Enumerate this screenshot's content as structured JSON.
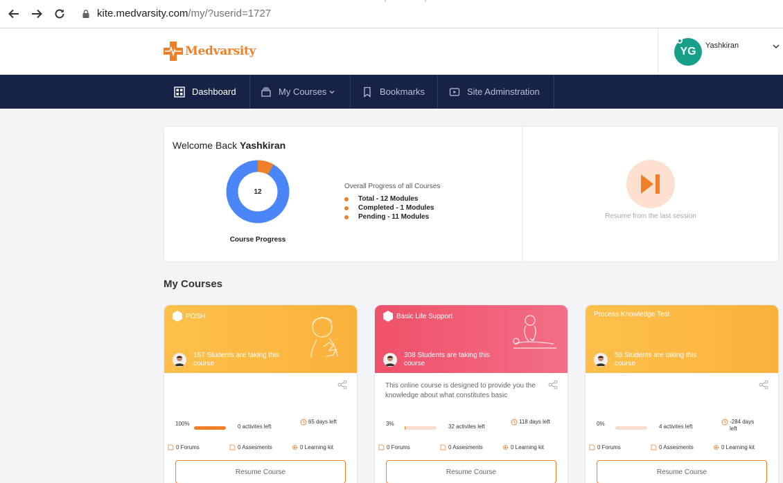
{
  "browser": {
    "url_host": "kite.medvarsity.com",
    "url_path": "/my/?userid=1727"
  },
  "header": {
    "logo_text": "Medvarsity",
    "user_initials": "YG",
    "user_name": "Yashkiran"
  },
  "nav": {
    "items": [
      {
        "label": "Dashboard",
        "icon": "dashboard-grid-icon",
        "active": true
      },
      {
        "label": "My Courses",
        "icon": "courses-stack-icon",
        "active": false
      },
      {
        "label": "Bookmarks",
        "icon": "bookmark-icon",
        "active": false
      },
      {
        "label": "Site Adminstration",
        "icon": "video-icon",
        "active": false
      }
    ]
  },
  "welcome": {
    "prefix": "Welcome Back",
    "name": "Yashkiran",
    "donut_center": "12",
    "donut_label": "Course Progress",
    "completed_fraction": 0.0833,
    "progress_heading": "Overall Progress of all Courses",
    "legend": [
      "Total - 12 Modules",
      "Completed - 1 Modules",
      "Pending - 11 Modules"
    ],
    "resume_label": "Resume from the last session"
  },
  "section": {
    "my_courses": "My Courses"
  },
  "courses": [
    {
      "title": "POSH",
      "students": "167 Students are taking this course",
      "description": "",
      "percent": "100%",
      "progress_fraction": 1.0,
      "activities_left": "0 activites left",
      "days_left": "65 days left",
      "forums": "0 Forums",
      "assessments": "0 Assesments",
      "learning_kit": "0 Learning kit",
      "button": "Resume Course",
      "theme": "yellow"
    },
    {
      "title": "Basic Life Support",
      "students": "308 Students are taking this course",
      "description": "This online course is designed to provide you the knowledge about what constitutes basic",
      "percent": "3%",
      "progress_fraction": 0.03,
      "activities_left": "32 activites left",
      "days_left": "118 days left",
      "forums": "0 Forums",
      "assessments": "0 Assesments",
      "learning_kit": "0 Learning kit",
      "button": "Resume Course",
      "theme": "pink"
    },
    {
      "title": "Process Knowledge Test",
      "students": "56 Students are taking this course",
      "description": "",
      "percent": "0%",
      "progress_fraction": 0.0,
      "activities_left": "4 activites left",
      "days_left": "-284 days left",
      "forums": "0 Forums",
      "assessments": "0 Assesments",
      "learning_kit": "0 Learning kit",
      "button": "Resume Course",
      "theme": "yellow"
    }
  ],
  "colors": {
    "nav_bg": "#162347",
    "accent": "#f07f2a",
    "donut_main": "#4a86f7",
    "donut_done": "#f07f2a",
    "avatar_bg": "#17a089"
  }
}
